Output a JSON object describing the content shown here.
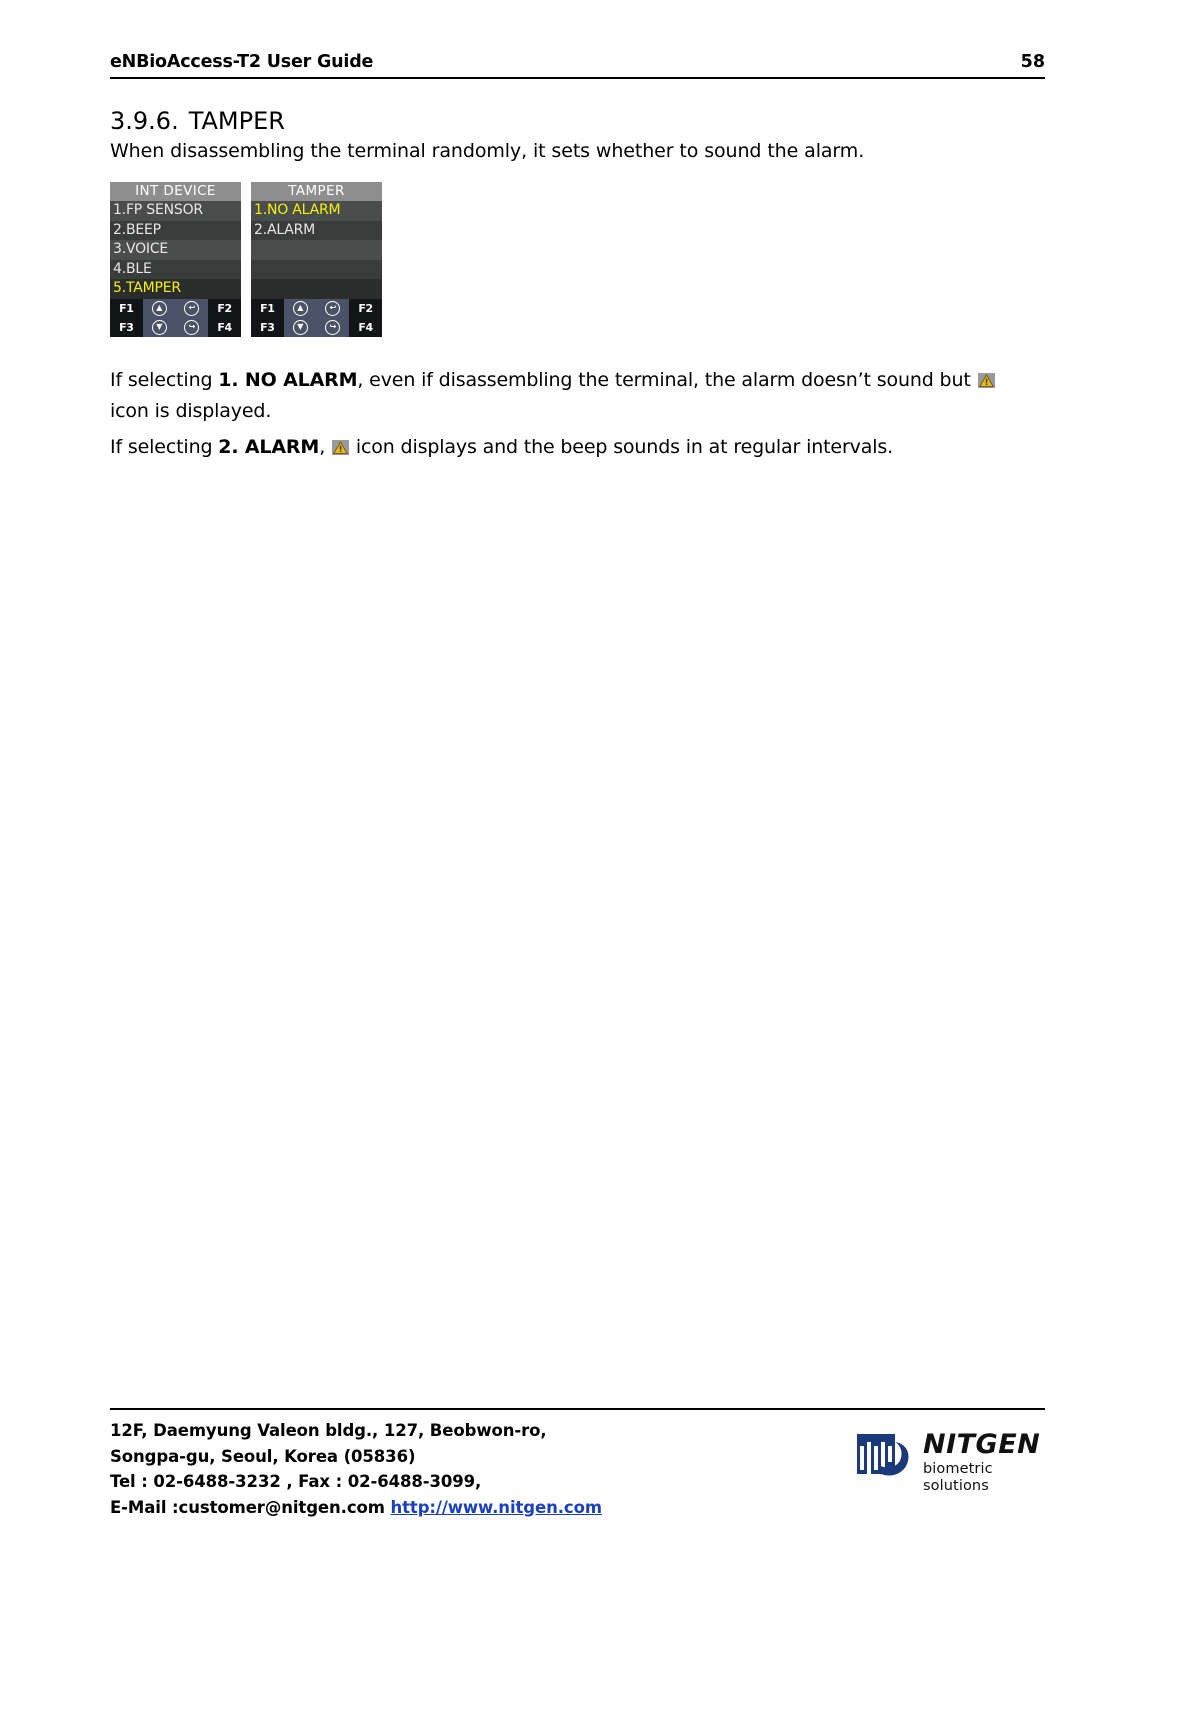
{
  "header": {
    "title": "eNBioAccess-T2 User Guide",
    "page_number": "58"
  },
  "section": {
    "number": "3.9.6.",
    "title": "TAMPER",
    "intro": "When disassembling the terminal randomly, it sets whether to sound the alarm."
  },
  "lcd_screens": [
    {
      "name": "int-device-menu",
      "title": "INT DEVICE",
      "rows": [
        {
          "label": "1.FP SENSOR",
          "state": "alt"
        },
        {
          "label": "2.BEEP",
          "state": "base"
        },
        {
          "label": "3.VOICE",
          "state": "alt"
        },
        {
          "label": "4.BLE",
          "state": "base"
        },
        {
          "label": "5.TAMPER",
          "state": "sel"
        }
      ],
      "keys_top": [
        "F1",
        "up-arrow-icon",
        "back-arrow-icon",
        "F2"
      ],
      "keys_bottom": [
        "F3",
        "down-arrow-icon",
        "forward-arrow-icon",
        "F4"
      ]
    },
    {
      "name": "tamper-menu",
      "title": "TAMPER",
      "rows": [
        {
          "label": "1.NO ALARM",
          "state": "sel-alt"
        },
        {
          "label": "2.ALARM",
          "state": "base"
        },
        {
          "label": "",
          "state": "alt"
        },
        {
          "label": "",
          "state": "base"
        },
        {
          "label": "",
          "state": "sel"
        }
      ],
      "keys_top": [
        "F1",
        "up-arrow-icon",
        "back-arrow-icon",
        "F2"
      ],
      "keys_bottom": [
        "F3",
        "down-arrow-icon",
        "forward-arrow-icon",
        "F4"
      ]
    }
  ],
  "paragraphs": {
    "p1_a": "If selecting ",
    "p1_bold": "1. NO ALARM",
    "p1_b": ", even if disassembling the terminal, the alarm doesn’t sound but ",
    "p1_c": "icon is displayed.",
    "p2_a": "If selecting ",
    "p2_bold": "2. ALARM",
    "p2_b": ", ",
    "p2_c": " icon displays and the beep sounds in at regular intervals."
  },
  "footer": {
    "address_line1": "12F, Daemyung Valeon bldg., 127, Beobwon-ro,",
    "address_line2": "Songpa-gu, Seoul, Korea (05836)",
    "address_line3": "Tel : 02-6488-3232 , Fax : 02-6488-3099,",
    "email_label": "E-Mail :customer@nitgen.com ",
    "website": "http://www.nitgen.com",
    "logo_name": "NITGEN",
    "logo_tagline": "biometric solutions"
  },
  "colors": {
    "link": "#1b3fbf",
    "lcd_selected_text": "#f2f20d",
    "lcd_title_bg": "#8e8e8e",
    "lcd_body_bg": "#3a3c3b",
    "lcd_key_nav": "#4a5268",
    "warn_icon_fill": "#e8b820"
  }
}
